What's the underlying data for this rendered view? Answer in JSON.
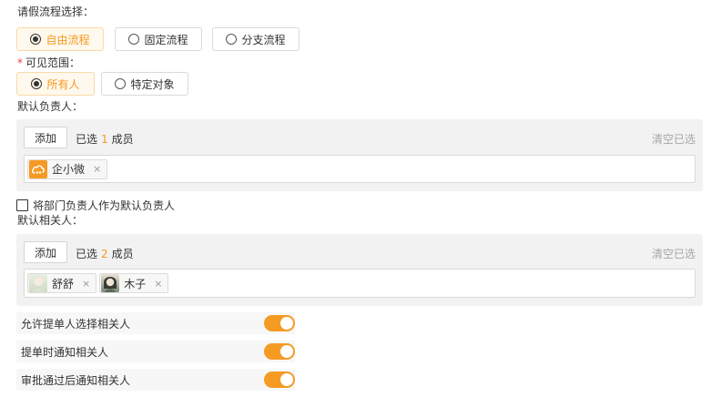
{
  "flow": {
    "label": "请假流程选择：",
    "options": [
      {
        "label": "自由流程",
        "selected": true
      },
      {
        "label": "固定流程",
        "selected": false
      },
      {
        "label": "分支流程",
        "selected": false
      }
    ]
  },
  "scope": {
    "required_mark": "*",
    "label": "可见范围：",
    "options": [
      {
        "label": "所有人",
        "selected": true
      },
      {
        "label": "特定对象",
        "selected": false
      }
    ]
  },
  "default_owner": {
    "label": "默认负责人：",
    "add_label": "添加",
    "selected_prefix": "已选",
    "count": "1",
    "selected_suffix": "成员",
    "clear_label": "清空已选",
    "members": [
      {
        "name": "企小微",
        "avatar_icon": "cloud-logo-icon"
      }
    ]
  },
  "dept_owner_checkbox": {
    "label": "将部门负责人作为默认负责人",
    "checked": false
  },
  "default_related": {
    "label": "默认相关人：",
    "add_label": "添加",
    "selected_prefix": "已选",
    "count": "2",
    "selected_suffix": "成员",
    "clear_label": "清空已选",
    "members": [
      {
        "name": "舒舒",
        "avatar_icon": "user-avatar-icon"
      },
      {
        "name": "木子",
        "avatar_icon": "user-avatar-icon"
      }
    ]
  },
  "settings": [
    {
      "label": "允许提单人选择相关人",
      "enabled": true
    },
    {
      "label": "提单时通知相关人",
      "enabled": true
    },
    {
      "label": "审批通过后通知相关人",
      "enabled": true
    }
  ],
  "colors": {
    "accent": "#f59a23",
    "panel": "#f2f2f2"
  },
  "close_glyph": "×"
}
